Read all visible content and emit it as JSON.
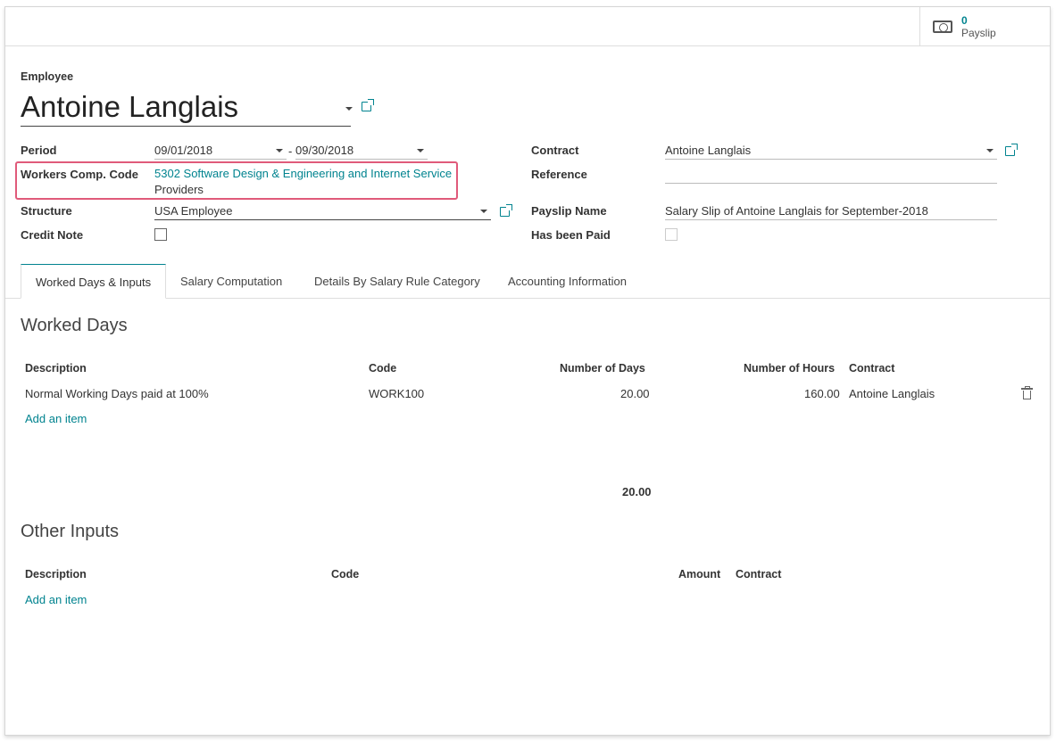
{
  "smart_button": {
    "count": "0",
    "label": "Payslip"
  },
  "employee": {
    "label": "Employee",
    "name": "Antoine Langlais"
  },
  "left_fields": {
    "period_label": "Period",
    "period_from": "09/01/2018",
    "period_sep": "-",
    "period_to": "09/30/2018",
    "wcc_label": "Workers Comp. Code",
    "wcc_value_line1": "5302 Software Design & Engineering and Internet Service",
    "wcc_value_line2": "Providers",
    "structure_label": "Structure",
    "structure_value": "USA Employee",
    "credit_note_label": "Credit Note"
  },
  "right_fields": {
    "contract_label": "Contract",
    "contract_value": "Antoine Langlais",
    "reference_label": "Reference",
    "reference_value": "",
    "payslip_name_label": "Payslip Name",
    "payslip_name_value": "Salary Slip of Antoine Langlais for September-2018",
    "has_been_paid_label": "Has been Paid"
  },
  "tabs": [
    {
      "label": "Worked Days & Inputs",
      "active": true
    },
    {
      "label": "Salary Computation",
      "active": false
    },
    {
      "label": "Details By Salary Rule Category",
      "active": false
    },
    {
      "label": "Accounting Information",
      "active": false
    }
  ],
  "worked_days": {
    "title": "Worked Days",
    "headers": [
      "Description",
      "Code",
      "Number of Days",
      "Number of Hours",
      "Contract"
    ],
    "rows": [
      {
        "description": "Normal Working Days paid at 100%",
        "code": "WORK100",
        "days": "20.00",
        "hours": "160.00",
        "contract": "Antoine Langlais"
      }
    ],
    "add_item": "Add an item",
    "total_days": "20.00"
  },
  "other_inputs": {
    "title": "Other Inputs",
    "headers": [
      "Description",
      "Code",
      "Amount",
      "Contract"
    ],
    "add_item": "Add an item"
  }
}
